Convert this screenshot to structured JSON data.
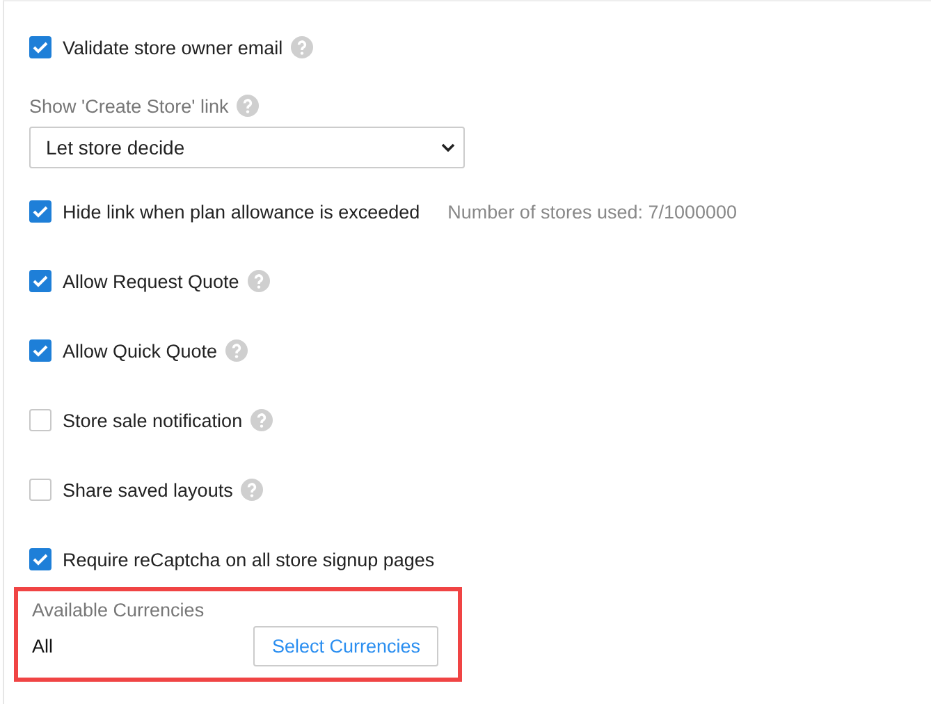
{
  "settings": [
    {
      "kind": "checkbox",
      "label": "Validate store owner email",
      "checked": true,
      "help": true
    },
    {
      "kind": "select",
      "label": "Show 'Create Store' link",
      "help": true,
      "value": "Let store decide"
    },
    {
      "kind": "checkbox",
      "label": "Hide link when plan allowance is exceeded",
      "checked": true,
      "help": false,
      "note": "Number of stores used: 7/1000000"
    },
    {
      "kind": "checkbox",
      "label": "Allow Request Quote",
      "checked": true,
      "help": true
    },
    {
      "kind": "checkbox",
      "label": "Allow Quick Quote",
      "checked": true,
      "help": true
    },
    {
      "kind": "checkbox",
      "label": "Store sale notification",
      "checked": false,
      "help": true
    },
    {
      "kind": "checkbox",
      "label": "Share saved layouts",
      "checked": false,
      "help": true
    },
    {
      "kind": "checkbox",
      "label": "Require reCaptcha on all store signup pages",
      "checked": true,
      "help": false
    }
  ],
  "currencies": {
    "label": "Available Currencies",
    "value": "All",
    "button": "Select Currencies",
    "highlighted": true
  }
}
